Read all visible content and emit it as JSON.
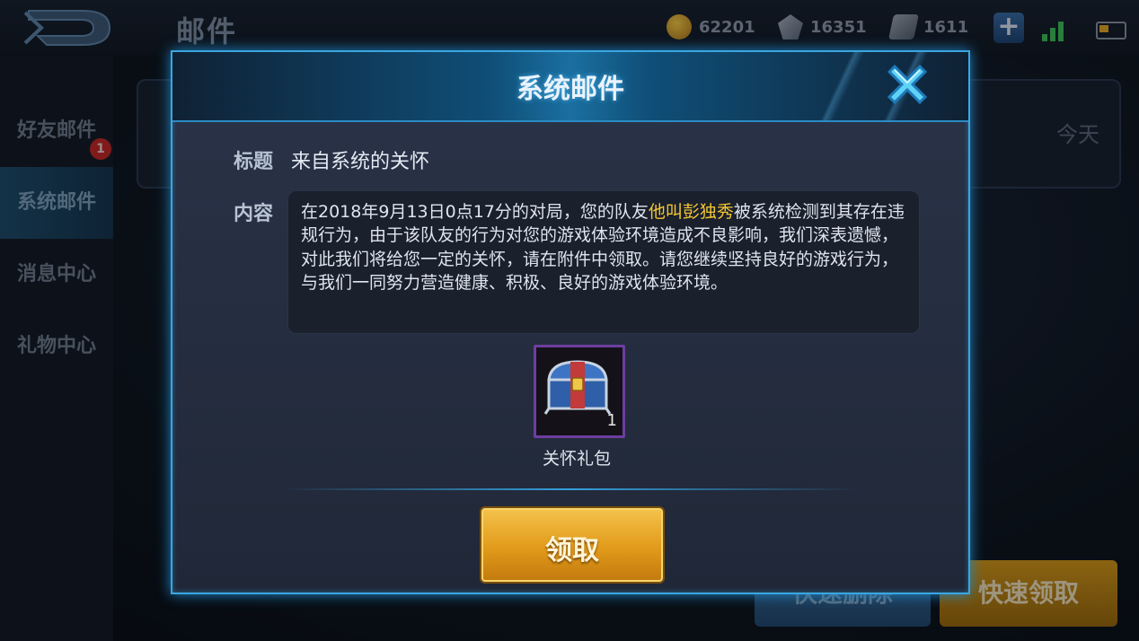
{
  "header": {
    "title": "邮件",
    "resources": [
      {
        "icon": "gold-coin-icon",
        "value": "62201"
      },
      {
        "icon": "diamond-icon",
        "value": "16351"
      },
      {
        "icon": "voucher-icon",
        "value": "1611"
      }
    ],
    "plus_icon": "plus-icon"
  },
  "sidebar": {
    "items": [
      {
        "label": "好友邮件",
        "badge": "1"
      },
      {
        "label": "系统邮件",
        "active": true
      },
      {
        "label": "消息中心"
      },
      {
        "label": "礼物中心"
      }
    ]
  },
  "mail_list": {
    "date_fragment": "今天"
  },
  "bottom_buttons": {
    "delete_label": "快速删除",
    "quick_claim_label": "快速领取"
  },
  "dialog": {
    "title": "系统邮件",
    "subject_label": "标题",
    "subject": "来自系统的关怀",
    "content_label": "内容",
    "content_before": "在2018年9月13日0点17分的对局，您的队友",
    "content_highlight": "他叫彭独秀",
    "content_after": "被系统检测到其存在违规行为，由于该队友的行为对您的游戏体验环境造成不良影响，我们深表遗憾，对此我们将给您一定的关怀，请在附件中领取。请您继续坚持良好的游戏行为，与我们一同努力营造健康、积极、良好的游戏体验环境。",
    "attachment": {
      "name": "关怀礼包",
      "count": "1",
      "icon": "treasure-chest-icon"
    },
    "claim_label": "领取"
  },
  "colors": {
    "accent_blue": "#3aa6e0",
    "highlight_yellow": "#f3c632",
    "claim_gold": "#e19a1a"
  }
}
